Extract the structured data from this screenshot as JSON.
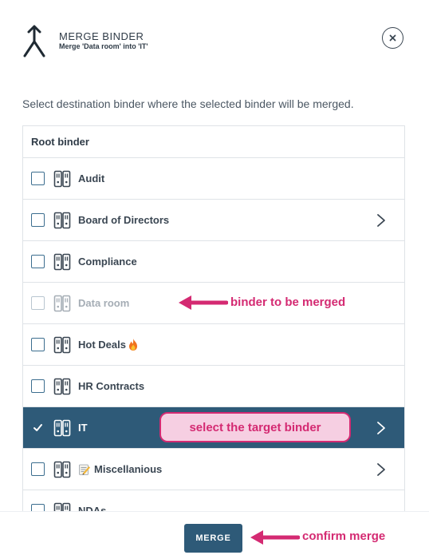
{
  "header": {
    "title": "MERGE BINDER",
    "subtitle": "Merge 'Data room' into 'IT'"
  },
  "instructions": "Select destination binder where the selected binder will be merged.",
  "list": {
    "root_label": "Root binder",
    "items": [
      {
        "label": "Audit",
        "has_children": false,
        "state": "normal"
      },
      {
        "label": "Board of Directors",
        "has_children": true,
        "state": "normal"
      },
      {
        "label": "Compliance",
        "has_children": false,
        "state": "normal"
      },
      {
        "label": "Data room",
        "has_children": false,
        "state": "disabled"
      },
      {
        "label": "Hot Deals",
        "emoji": "fire",
        "has_children": false,
        "state": "normal"
      },
      {
        "label": "HR Contracts",
        "has_children": false,
        "state": "normal"
      },
      {
        "label": "IT",
        "has_children": true,
        "state": "selected"
      },
      {
        "label": "Miscellanious",
        "emoji": "memo",
        "has_children": true,
        "state": "normal"
      },
      {
        "label": "NDAs",
        "has_children": false,
        "state": "normal"
      }
    ]
  },
  "footer": {
    "merge_label": "MERGE"
  },
  "annotations": {
    "binder_to_merge": "binder to be merged",
    "select_target": "select the target binder",
    "confirm_merge": "confirm merge"
  },
  "colors": {
    "primary": "#2e5a78",
    "annotation": "#d42a72",
    "annotation_fill": "#f6cfe2",
    "text": "#2f3b47",
    "disabled_text": "#a5adb5"
  }
}
